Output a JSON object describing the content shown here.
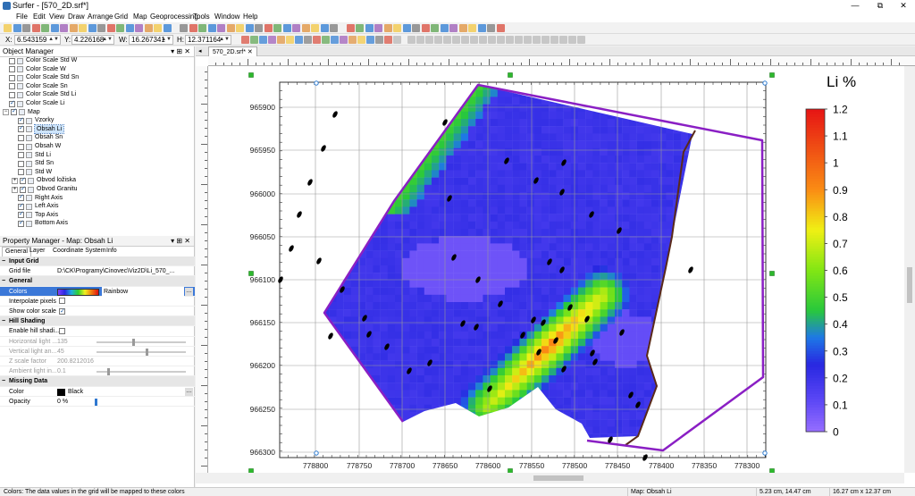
{
  "window": {
    "title": "Surfer - [570_2D.srf*]",
    "minimize": "—",
    "maximize": "⧉",
    "close": "✕"
  },
  "menu": [
    "File",
    "Edit",
    "View",
    "Draw",
    "Arrange",
    "Grid",
    "Map",
    "Geoprocessing",
    "Tools",
    "Window",
    "Help"
  ],
  "coords": {
    "x_label": "X:",
    "x_value": "6.543159",
    "y_label": "Y:",
    "y_value": "4.226168",
    "w_label": "W:",
    "w_value": "16.267341",
    "h_label": "H:",
    "h_value": "12.371164"
  },
  "object_manager": {
    "title": "Object Manager",
    "items": [
      {
        "label": "Color Scale Std W",
        "checked": false,
        "indent": 0
      },
      {
        "label": "Color Scale W",
        "checked": false,
        "indent": 0
      },
      {
        "label": "Color Scale Std Sn",
        "checked": false,
        "indent": 0
      },
      {
        "label": "Color Scale Sn",
        "checked": false,
        "indent": 0
      },
      {
        "label": "Color Scale Std Li",
        "checked": false,
        "indent": 0
      },
      {
        "label": "Color Scale Li",
        "checked": true,
        "indent": 0
      },
      {
        "label": "Map",
        "checked": true,
        "indent": 0,
        "expander": "−"
      },
      {
        "label": "Vzorky",
        "checked": true,
        "indent": 1
      },
      {
        "label": "Obsah Li",
        "checked": true,
        "indent": 1,
        "selected": true
      },
      {
        "label": "Obsah Sn",
        "checked": false,
        "indent": 1
      },
      {
        "label": "Obsah W",
        "checked": false,
        "indent": 1
      },
      {
        "label": "Std Li",
        "checked": false,
        "indent": 1
      },
      {
        "label": "Std Sn",
        "checked": false,
        "indent": 1
      },
      {
        "label": "Std W",
        "checked": false,
        "indent": 1
      },
      {
        "label": "Obvod ložiska",
        "checked": true,
        "indent": 1,
        "expander": "+"
      },
      {
        "label": "Obvod Granitu",
        "checked": true,
        "indent": 1,
        "expander": "+"
      },
      {
        "label": "Right Axis",
        "checked": true,
        "indent": 1
      },
      {
        "label": "Left Axis",
        "checked": true,
        "indent": 1
      },
      {
        "label": "Top Axis",
        "checked": true,
        "indent": 1
      },
      {
        "label": "Bottom Axis",
        "checked": true,
        "indent": 1
      }
    ]
  },
  "property_manager": {
    "title": "Property Manager - Map: Obsah Li",
    "tabs": [
      "General",
      "Layer",
      "Coordinate System",
      "Info"
    ],
    "rows": [
      {
        "type": "section",
        "name": "Input Grid"
      },
      {
        "type": "prop",
        "name": "Grid file",
        "value": "D:\\CK\\Programy\\Cinovec\\Viz2D\\Li_570_..."
      },
      {
        "type": "section",
        "name": "General"
      },
      {
        "type": "prop",
        "name": "Colors",
        "value": "Rainbow",
        "kind": "colors",
        "selected": true
      },
      {
        "type": "prop",
        "name": "Interpolate pixels",
        "kind": "check",
        "checked": false
      },
      {
        "type": "prop",
        "name": "Show color scale",
        "kind": "check",
        "checked": true
      },
      {
        "type": "section",
        "name": "Hill Shading"
      },
      {
        "type": "prop",
        "name": "Enable hill shadi...",
        "kind": "check",
        "checked": false
      },
      {
        "type": "prop",
        "name": "Horizontal light ...",
        "value": "135",
        "kind": "slider",
        "disabled": true,
        "pos": 0.4
      },
      {
        "type": "prop",
        "name": "Vertical light an...",
        "value": "45",
        "kind": "slider",
        "disabled": true,
        "pos": 0.55
      },
      {
        "type": "prop",
        "name": "Z scale factor",
        "value": "200.8212016",
        "disabled": true
      },
      {
        "type": "prop",
        "name": "Ambient light in...",
        "value": "0.1",
        "kind": "slider",
        "disabled": true,
        "pos": 0.12
      },
      {
        "type": "section",
        "name": "Missing Data"
      },
      {
        "type": "prop",
        "name": "Color",
        "value": "Black",
        "kind": "color"
      },
      {
        "type": "prop",
        "name": "Opacity",
        "value": "0 %",
        "kind": "opacity"
      }
    ]
  },
  "document_tab": "570_2D.srf*",
  "map": {
    "y_ticks": [
      "965900",
      "965950",
      "966000",
      "966050",
      "966100",
      "966150",
      "966200",
      "966250",
      "966300"
    ],
    "x_ticks": [
      "778800",
      "778750",
      "778700",
      "778650",
      "778600",
      "778550",
      "778500",
      "778450",
      "778400",
      "778350",
      "778300"
    ],
    "colorbar_title": "Li %",
    "colorbar_ticks": [
      "1.2",
      "1.1",
      "1",
      "0.9",
      "0.8",
      "0.7",
      "0.6",
      "0.5",
      "0.4",
      "0.3",
      "0.2",
      "0.1",
      "0"
    ],
    "colors": {
      "boundary": "#8a1fc4",
      "granite": "#5a2a1a",
      "base_fill": "#2b25e0",
      "grid_line": "#9a9a9a"
    }
  },
  "status": {
    "message": "Colors: The data values in the grid will be mapped to these colors",
    "map_name": "Map: Obsah Li",
    "position": "5.23 cm, 14.47 cm",
    "size": "16.27 cm x 12.37 cm"
  }
}
